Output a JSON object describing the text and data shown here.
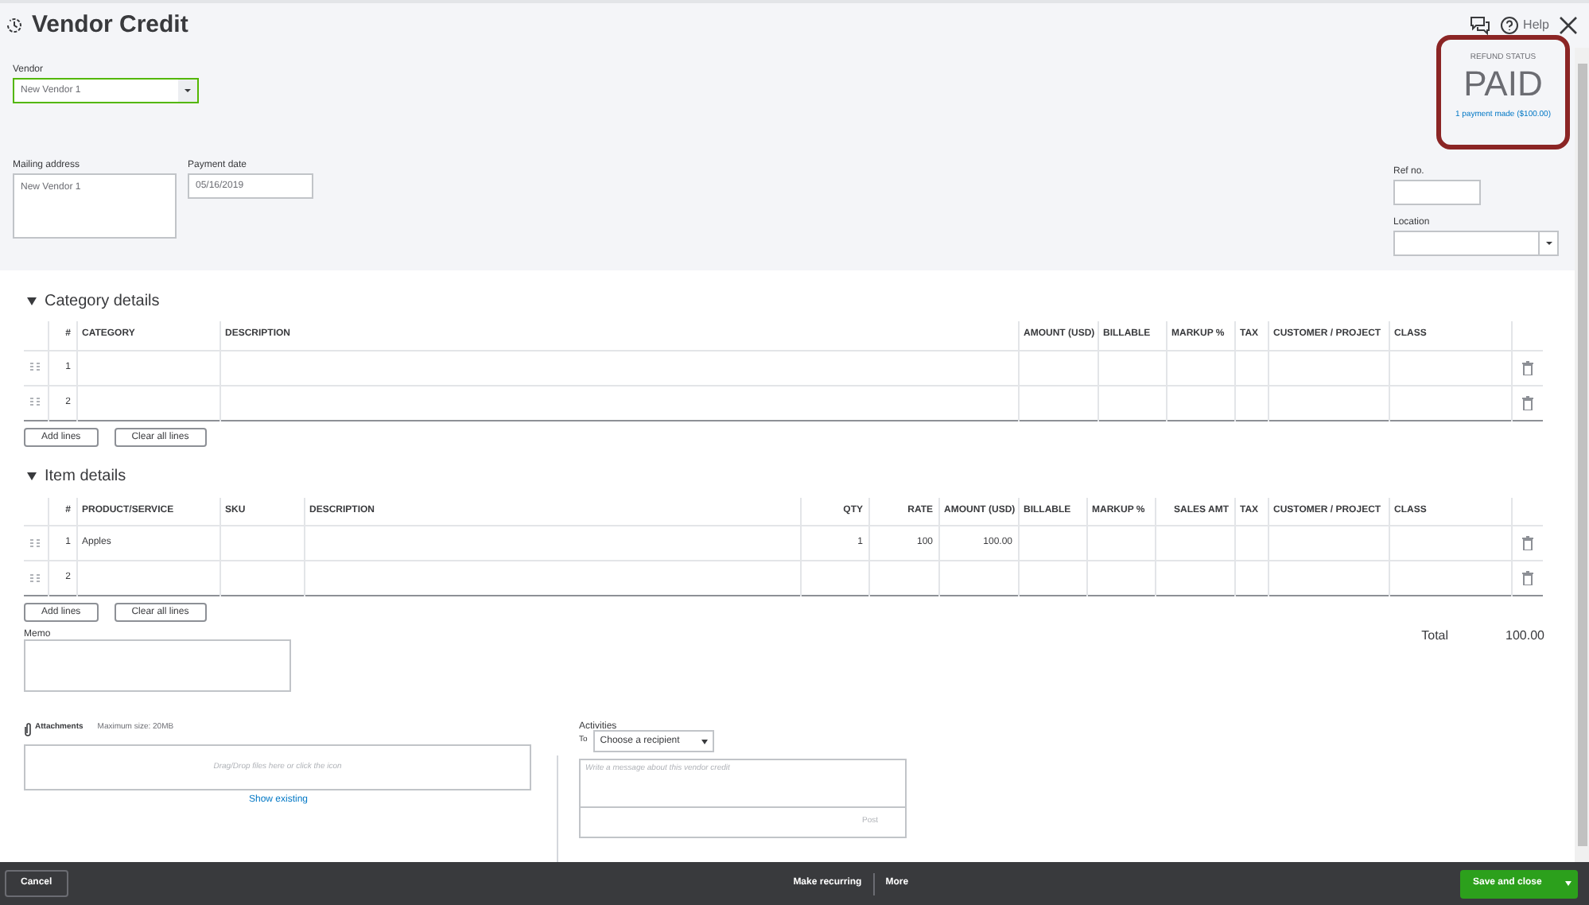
{
  "title": "Vendor Credit",
  "header_actions": {
    "help": "Help"
  },
  "vendor": {
    "label": "Vendor",
    "value": "New Vendor 1",
    "focused": true
  },
  "mailing_address": {
    "label": "Mailing address",
    "value": "New Vendor 1"
  },
  "payment_date": {
    "label": "Payment date",
    "value": "05/16/2019"
  },
  "refund_status": {
    "label": "REFUND STATUS",
    "status": "PAID",
    "link": "1 payment made ($100.00)"
  },
  "ref_no": {
    "label": "Ref no."
  },
  "location": {
    "label": "Location"
  },
  "category_details": {
    "title": "Category details",
    "expanded": true,
    "columns": [
      "#",
      "CATEGORY",
      "DESCRIPTION",
      "AMOUNT (USD)",
      "BILLABLE",
      "MARKUP %",
      "TAX",
      "CUSTOMER / PROJECT",
      "CLASS"
    ],
    "rows": [
      {
        "number": "1"
      },
      {
        "number": "2"
      }
    ],
    "buttons": [
      "Add lines",
      "Clear all lines"
    ]
  },
  "item_details": {
    "title": "Item details",
    "expanded": true,
    "columns": [
      "#",
      "PRODUCT/SERVICE",
      "SKU",
      "DESCRIPTION",
      "QTY",
      "RATE",
      "AMOUNT (USD)",
      "BILLABLE",
      "MARKUP %",
      "SALES AMT",
      "TAX",
      "CUSTOMER / PROJECT",
      "CLASS"
    ],
    "rows": [
      {
        "number": "1",
        "product_service": "Apples",
        "qty": "1",
        "rate": "100",
        "amount": "100.00"
      },
      {
        "number": "2"
      }
    ],
    "buttons": [
      "Add lines",
      "Clear all lines"
    ]
  },
  "memo": {
    "label": "Memo"
  },
  "total": {
    "label": "Total",
    "value": "100.00"
  },
  "attachments": {
    "label": "Attachments",
    "max_size": "Maximum size: 20MB",
    "drop_hint": "Drag/Drop files here or click the icon",
    "link": "Show existing"
  },
  "activities": {
    "label": "Activities",
    "to": "To",
    "recipient": "Choose a recipient",
    "placeholder": "Write a message about this vendor credit",
    "post": "Post"
  },
  "footer": {
    "cancel": "Cancel",
    "make_recurring": "Make recurring",
    "more": "More",
    "save": "Save and close"
  }
}
